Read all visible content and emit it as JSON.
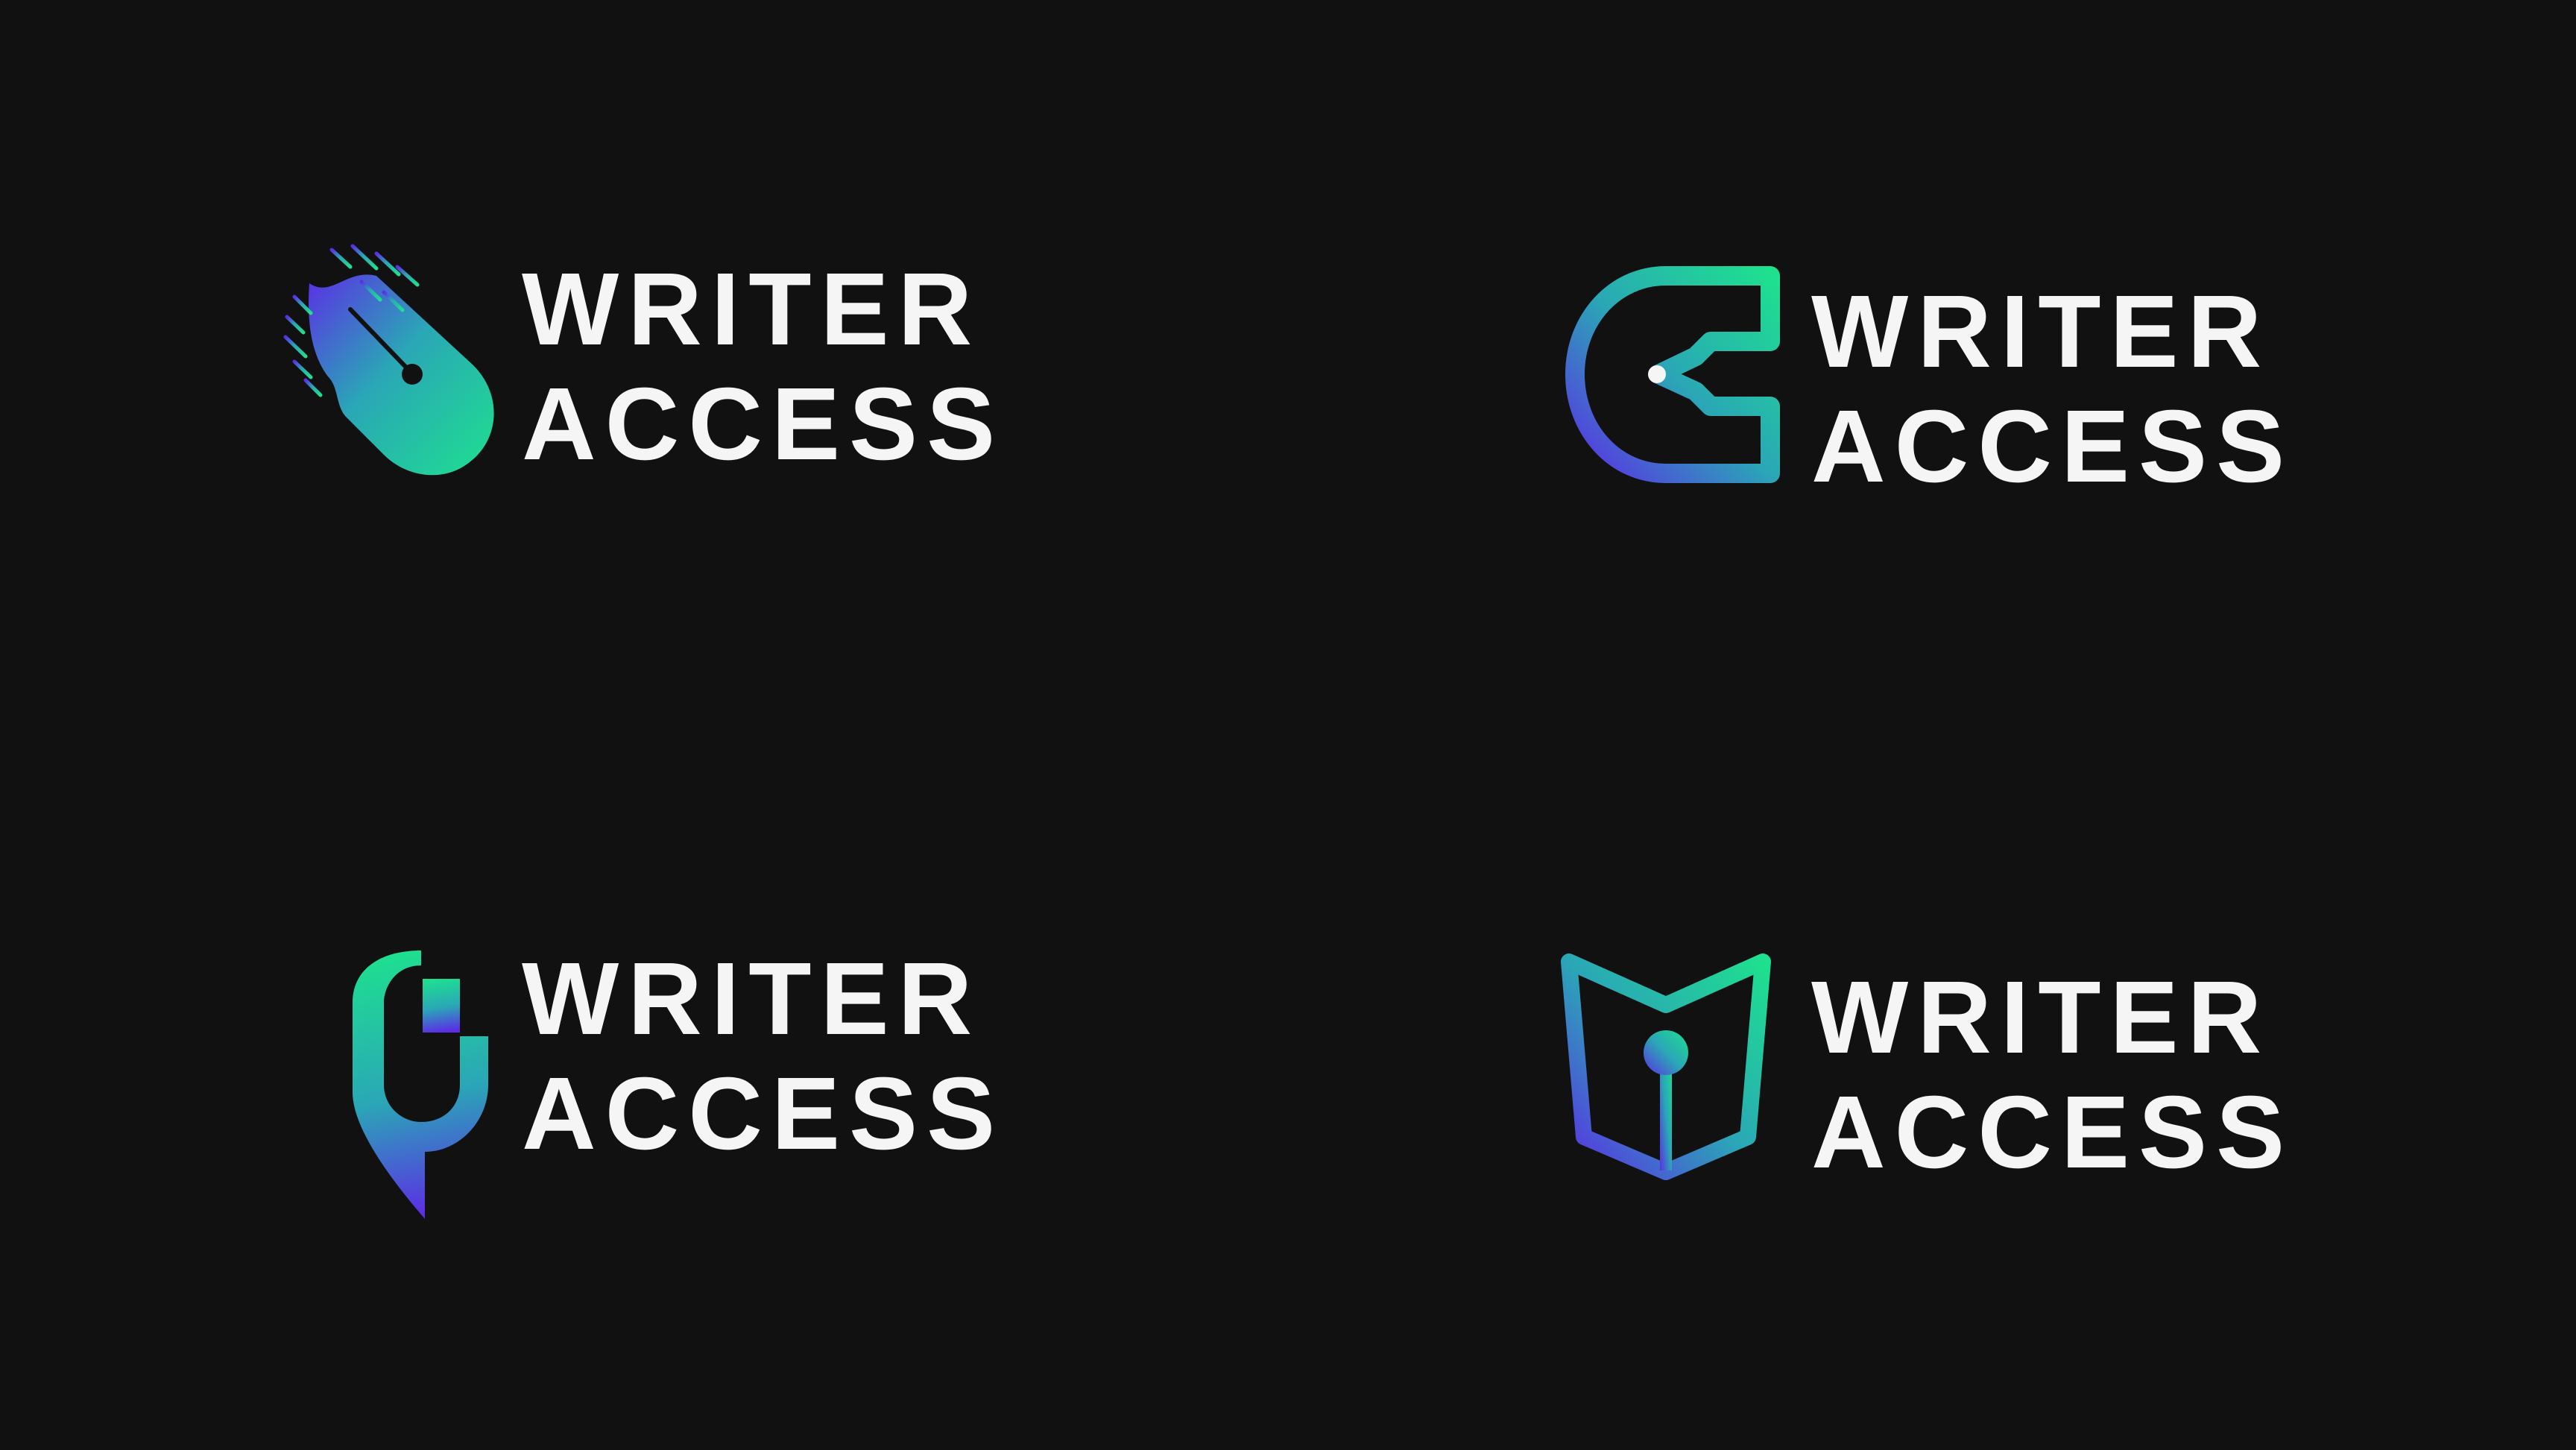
{
  "canvas": {
    "background": "#111111"
  },
  "colors": {
    "gradient_green": "#1ee08f",
    "gradient_teal": "#2aa7b6",
    "gradient_purple": "#5b2ee5",
    "text": "#f5f5f5"
  },
  "logos": [
    {
      "icon": "comet-pen-icon",
      "line1": "WRITER",
      "line2": "ACCESS"
    },
    {
      "icon": "letter-c-pen-nib-icon",
      "line1": "WRITER",
      "line2": "ACCESS"
    },
    {
      "icon": "pen-pixel-pin-icon",
      "line1": "WRITER",
      "line2": "ACCESS"
    },
    {
      "icon": "open-book-nib-icon",
      "line1": "WRITER",
      "line2": "ACCESS"
    }
  ]
}
